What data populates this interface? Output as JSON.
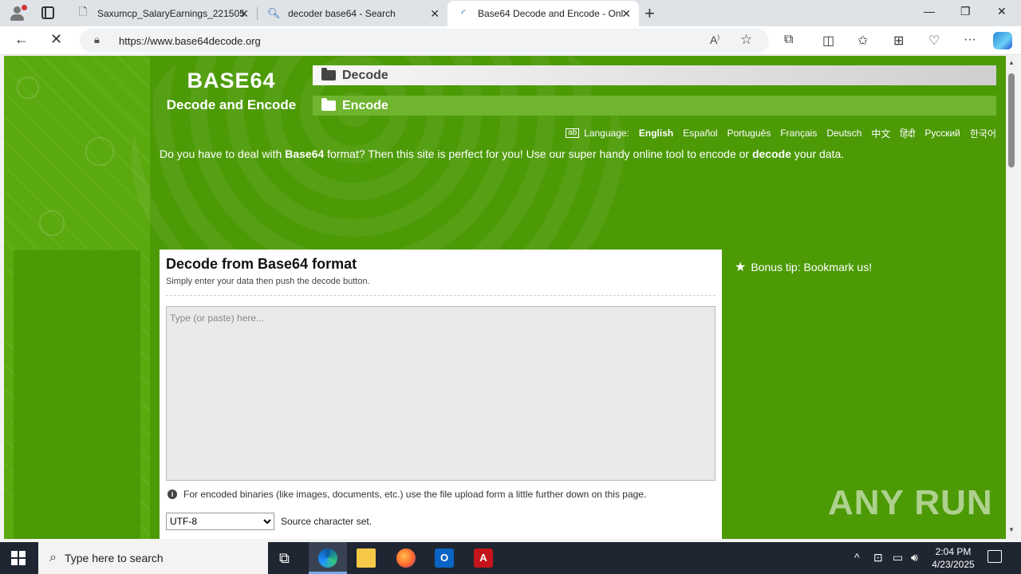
{
  "browser": {
    "tabs": [
      {
        "title": "Saxumcp_SalaryEarnings_221505",
        "icon": "document-icon"
      },
      {
        "title": "decoder base64 - Search",
        "icon": "search-icon"
      },
      {
        "title": "Base64 Decode and Encode - Onl",
        "icon": "loading-icon"
      }
    ],
    "url": "https://www.base64decode.org"
  },
  "site": {
    "logo_title": "BASE64",
    "logo_subtitle": "Decode and Encode",
    "menu": {
      "decode": "Decode",
      "encode": "Encode"
    },
    "language_label": "Language:",
    "languages": [
      "English",
      "Español",
      "Português",
      "Français",
      "Deutsch",
      "中文",
      "हिंदी",
      "Русский",
      "한국어"
    ],
    "intro": {
      "part1": "Do you have to deal with ",
      "bold1": "Base64",
      "part2": " format? Then this site is perfect for you! Use our super handy online tool to encode or ",
      "bold2": "decode",
      "part3": " your data."
    },
    "panel": {
      "title": "Decode from Base64 format",
      "subtitle": "Simply enter your data then push the decode button.",
      "placeholder": "Type (or paste) here...",
      "note": "For encoded binaries (like images, documents, etc.) use the file upload form a little further down on this page.",
      "charset_value": "UTF-8",
      "charset_label": "Source character set."
    },
    "bonus_tip": "Bonus tip: Bookmark us!",
    "watermark": "ANY RUN"
  },
  "taskbar": {
    "search_placeholder": "Type here to search",
    "time": "2:04 PM",
    "date": "4/23/2025"
  }
}
